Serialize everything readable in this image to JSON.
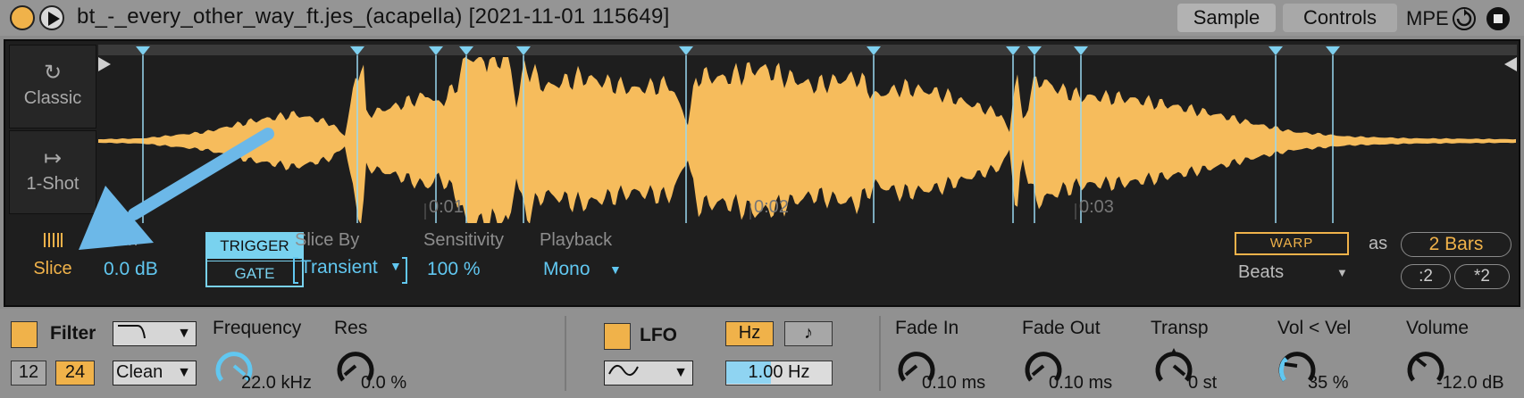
{
  "title_bar": {
    "title": "bt_-_every_other_way_ft.jes_(acapella) [2021-11-01 115649]",
    "tabs": [
      "Sample",
      "Controls"
    ],
    "mpe_label": "MPE"
  },
  "modes": {
    "classic": "Classic",
    "one_shot": "1-Shot",
    "slice": "Slice",
    "active": "Slice"
  },
  "timeline": {
    "markers": [
      "0:01",
      "0:02",
      "0:03"
    ]
  },
  "params": {
    "gain_label": "Gain",
    "gain_value": "0.0 dB",
    "trigger_label": "TRIGGER",
    "gate_label": "GATE",
    "slice_by_label": "Slice By",
    "slice_by_value": "Transient",
    "sensitivity_label": "Sensitivity",
    "sensitivity_value": "100 %",
    "playback_label": "Playback",
    "playback_value": "Mono",
    "warp_label": "WARP",
    "as_label": "as",
    "bars_value": "2 Bars",
    "beats_value": "Beats",
    "half_label": ":2",
    "double_label": "*2"
  },
  "filter": {
    "label": "Filter",
    "slope_12": "12",
    "slope_24": "24",
    "active_slope": "24",
    "circuit": "Clean",
    "frequency_label": "Frequency",
    "frequency_value": "22.0 kHz",
    "res_label": "Res",
    "res_value": "0.0 %"
  },
  "lfo": {
    "label": "LFO",
    "hz_label": "Hz",
    "rate_value": "1.00 Hz"
  },
  "envelope": {
    "fade_in_label": "Fade In",
    "fade_in_value": "0.10 ms",
    "fade_out_label": "Fade Out",
    "fade_out_value": "0.10 ms",
    "transp_label": "Transp",
    "transp_value": "0 st",
    "vol_vel_label": "Vol < Vel",
    "vol_vel_value": "35 %",
    "volume_label": "Volume",
    "volume_value": "-12.0 dB"
  },
  "colors": {
    "accent_orange": "#f0b24a",
    "accent_blue": "#61c7f0",
    "waveform": "#f6bc5c",
    "panel_bg": "#1e1e1e"
  }
}
